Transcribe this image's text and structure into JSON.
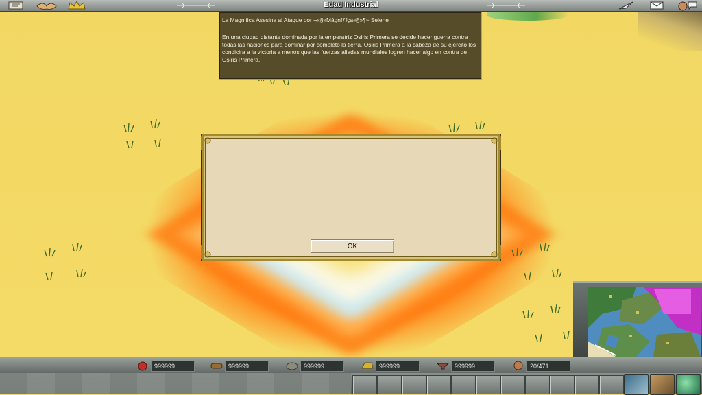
{
  "topbar": {
    "title": "Edad Industrial",
    "left_icons": [
      "scroll-icon",
      "handshake-icon",
      "crown-icon"
    ],
    "right_icons": [
      "quill-icon",
      "mail-icon",
      "advisor-icon"
    ]
  },
  "info_panel": {
    "title": "La Magnifica Asesina al Ataque por ¬«§»Mâgnîƒîça«§»¶~ Selene",
    "body": "En una ciudad distante dominada por la emperatriz Osiris Primera se decide hacer guerra contra todas las naciones para dominar por completo la tierra. Osiris Primera a la cabeza de su ejercito los condicira a la victoria a menos que las fuerzas aliadas mundiales logren hacer algo en contra de Osiris Primera."
  },
  "dialog": {
    "ok_label": "OK"
  },
  "resources": [
    {
      "icon": "food-icon",
      "value": "999999",
      "color": "#c0302a"
    },
    {
      "icon": "wood-icon",
      "value": "999999",
      "color": "#9a6b2e"
    },
    {
      "icon": "stone-icon",
      "value": "999999",
      "color": "#8c8a7a"
    },
    {
      "icon": "gold-icon",
      "value": "999999",
      "color": "#d9b22c"
    },
    {
      "icon": "iron-icon",
      "value": "999999",
      "color": "#8e4a3a"
    },
    {
      "icon": "population-icon",
      "value": "20/471",
      "color": "#c07a4a"
    }
  ],
  "command_buttons": [
    "unit-icon",
    "citizens-icon",
    "globe-icon"
  ]
}
